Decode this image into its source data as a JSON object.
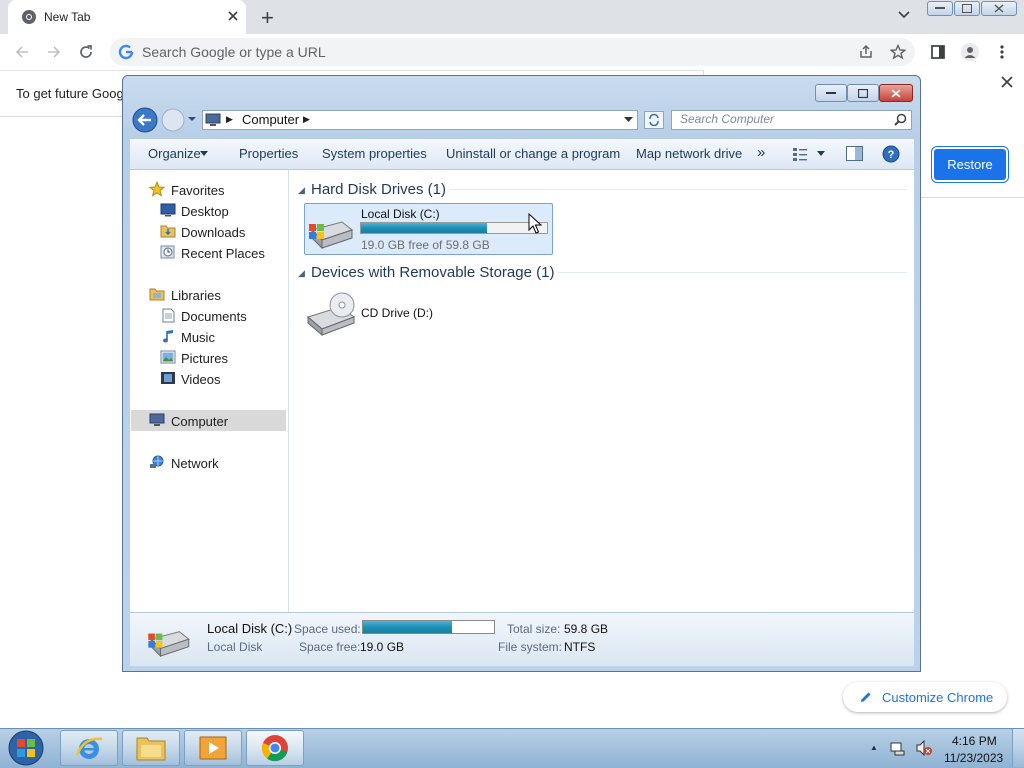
{
  "chrome": {
    "tab_title": "New Tab",
    "new_tab_symbol": "+",
    "omnibox_placeholder": "Search Google or type a URL",
    "infobar_text": "To get future Goog",
    "restore_label": "Restore",
    "customize_label": "Customize Chrome"
  },
  "explorer": {
    "breadcrumb": "Computer",
    "search_placeholder": "Search Computer",
    "commands": {
      "organize": "Organize",
      "properties": "Properties",
      "system_properties": "System properties",
      "uninstall": "Uninstall or change a program",
      "map_drive": "Map network drive",
      "more": "»"
    },
    "nav": {
      "favorites": "Favorites",
      "desktop": "Desktop",
      "downloads": "Downloads",
      "recent": "Recent Places",
      "libraries": "Libraries",
      "documents": "Documents",
      "music": "Music",
      "pictures": "Pictures",
      "videos": "Videos",
      "computer": "Computer",
      "network": "Network"
    },
    "groups": {
      "hdd_header": "Hard Disk Drives (1)",
      "removable_header": "Devices with Removable Storage (1)"
    },
    "drive_c": {
      "name": "Local Disk (C:)",
      "free_text": "19.0 GB free of 59.8 GB",
      "used_fraction": 0.68
    },
    "drive_d": {
      "name": "CD Drive (D:)"
    },
    "details": {
      "title": "Local Disk (C:)",
      "subtitle": "Local Disk",
      "space_used_label": "Space used:",
      "space_free_label": "Space free:",
      "space_free_value": "19.0 GB",
      "total_size_label": "Total size:",
      "total_size_value": "59.8 GB",
      "file_system_label": "File system:",
      "file_system_value": "NTFS",
      "used_fraction": 0.68
    }
  },
  "taskbar": {
    "time": "4:16 PM",
    "date": "11/23/2023"
  },
  "colors": {
    "chrome_blue": "#1a73e8",
    "aero_blue": "#b8cfe8",
    "drive_bar": "#1e8fb5",
    "close_red": "#c8423a"
  },
  "icons": [
    "chrome-icon",
    "close-icon",
    "plus-icon",
    "chevron-down-icon",
    "minimize-icon",
    "maximize-icon",
    "back-arrow-icon",
    "forward-arrow-icon",
    "reload-icon",
    "google-icon",
    "share-icon",
    "star-icon",
    "side-panel-icon",
    "profile-icon",
    "menu-icon",
    "search-icon",
    "refresh-icon",
    "help-icon",
    "star-icon",
    "desktop-icon",
    "folder-icon",
    "clock-icon",
    "library-icon",
    "document-icon",
    "music-icon",
    "pictures-icon",
    "video-icon",
    "computer-icon",
    "network-icon",
    "hard-drive-icon",
    "cd-drive-icon",
    "pencil-icon",
    "windows-start-icon",
    "ie-icon",
    "explorer-icon",
    "media-player-icon",
    "speaker-icon"
  ]
}
